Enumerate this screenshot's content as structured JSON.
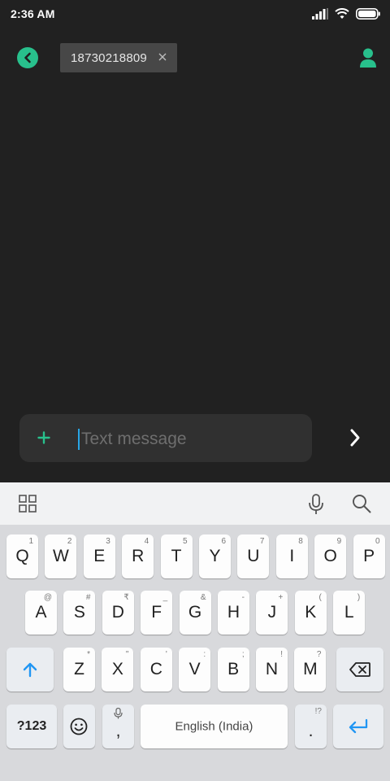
{
  "status_bar": {
    "time": "2:36 AM"
  },
  "top_bar": {
    "recipient_number": "18730218809"
  },
  "compose": {
    "placeholder": "Text message"
  },
  "keyboard": {
    "row1": [
      {
        "key": "Q",
        "hint": "1"
      },
      {
        "key": "W",
        "hint": "2"
      },
      {
        "key": "E",
        "hint": "3"
      },
      {
        "key": "R",
        "hint": "4"
      },
      {
        "key": "T",
        "hint": "5"
      },
      {
        "key": "Y",
        "hint": "6"
      },
      {
        "key": "U",
        "hint": "7"
      },
      {
        "key": "I",
        "hint": "8"
      },
      {
        "key": "O",
        "hint": "9"
      },
      {
        "key": "P",
        "hint": "0"
      }
    ],
    "row2": [
      {
        "key": "A",
        "hint": "@"
      },
      {
        "key": "S",
        "hint": "#"
      },
      {
        "key": "D",
        "hint": "₹"
      },
      {
        "key": "F",
        "hint": "_"
      },
      {
        "key": "G",
        "hint": "&"
      },
      {
        "key": "H",
        "hint": "-"
      },
      {
        "key": "J",
        "hint": "+"
      },
      {
        "key": "K",
        "hint": "("
      },
      {
        "key": "L",
        "hint": ")"
      }
    ],
    "row3": [
      {
        "key": "Z",
        "hint": "*"
      },
      {
        "key": "X",
        "hint": "\""
      },
      {
        "key": "C",
        "hint": "'"
      },
      {
        "key": "V",
        "hint": ":"
      },
      {
        "key": "B",
        "hint": ";"
      },
      {
        "key": "N",
        "hint": "!"
      },
      {
        "key": "M",
        "hint": "?"
      }
    ],
    "symbols_label": "?123",
    "comma": ",",
    "space_label": "English (India)",
    "period": ".",
    "period_hint": "!?"
  },
  "colors": {
    "accent": "#28c08c",
    "caret": "#28a6e6",
    "enter": "#2196f3"
  }
}
